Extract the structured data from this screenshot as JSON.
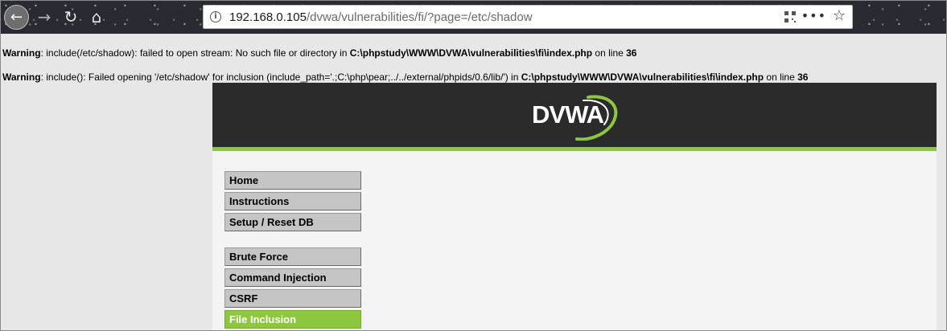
{
  "browser": {
    "url_host": "192.168.0.105",
    "url_path": "/dvwa/vulnerabilities/fi/?page=/etc/shadow"
  },
  "warnings": [
    {
      "label": "Warning",
      "message": ": include(/etc/shadow): failed to open stream: No such file or directory in ",
      "file": "C:\\phpstudy\\WWW\\DVWA\\vulnerabilities\\fi\\index.php",
      "on_line": " on line ",
      "line": "36"
    },
    {
      "label": "Warning",
      "message": ": include(): Failed opening '/etc/shadow' for inclusion (include_path='.;C:\\php\\pear;../../external/phpids/0.6/lib/') in ",
      "file": "C:\\phpstudy\\WWW\\DVWA\\vulnerabilities\\fi\\index.php",
      "on_line": " on line ",
      "line": "36"
    }
  ],
  "dvwa": {
    "logo_text": "DVWA",
    "colors": {
      "header": "#2b2b2b",
      "accent": "#8dc63f"
    },
    "menu": {
      "group1": [
        "Home",
        "Instructions",
        "Setup / Reset DB"
      ],
      "group2": [
        "Brute Force",
        "Command Injection",
        "CSRF",
        "File Inclusion"
      ],
      "active": "File Inclusion"
    }
  }
}
